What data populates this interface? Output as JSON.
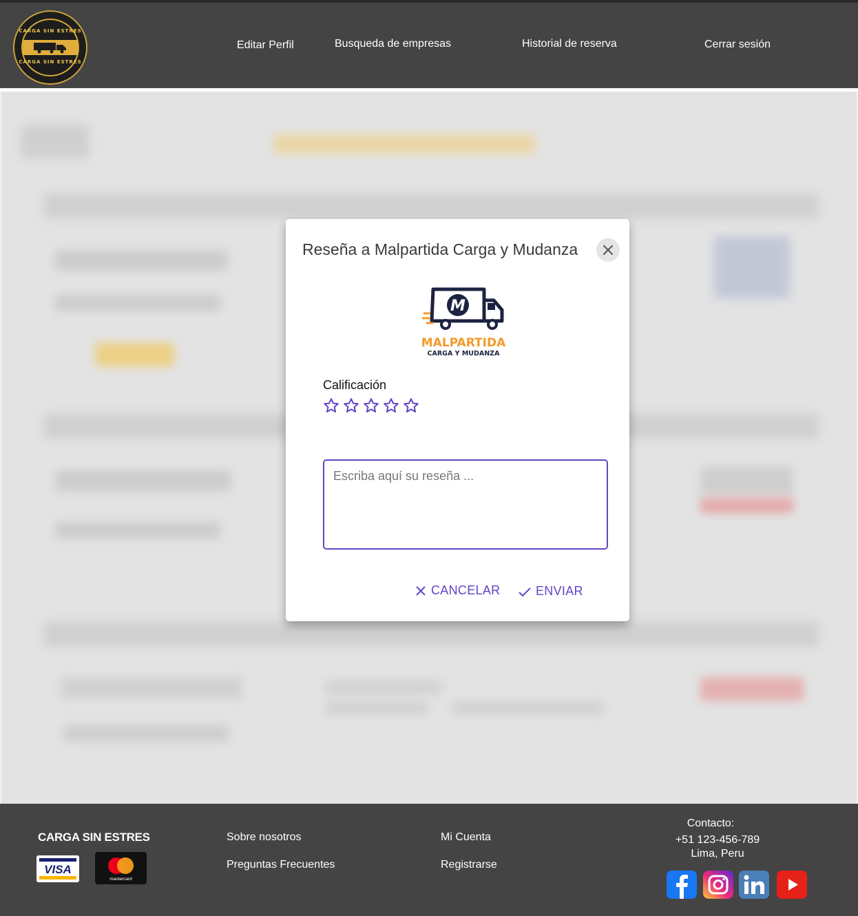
{
  "header": {
    "logo_text_top": "CARGA SIN ESTRES",
    "logo_text_bottom": "CARGA SIN ESTRES",
    "nav": {
      "edit_profile": "Editar Perfil",
      "company_search": "Busqueda de empresas",
      "booking_history": "Historial de reserva",
      "logout": "Cerrar sesión"
    }
  },
  "modal": {
    "title": "Reseña a Malpartida Carga y Mudanza",
    "company_logo": {
      "name": "MALPARTIDA",
      "tagline": "CARGA Y MUDANZA",
      "monogram": "M"
    },
    "rating_label": "Calificación",
    "stars": 5,
    "rating_value": 0,
    "review_placeholder": "Escriba aquí su reseña ...",
    "review_value": "",
    "cancel_label": "CANCELAR",
    "send_label": "ENVIAR"
  },
  "footer": {
    "brand": "CARGA SIN ESTRES",
    "links": {
      "about": "Sobre nosotros",
      "faq": "Preguntas Frecuentes",
      "account": "Mi Cuenta",
      "register": "Registrarse"
    },
    "contact": {
      "label": "Contacto:",
      "phone": "+51 123-456-789",
      "city": "Lima, Peru"
    },
    "payments": {
      "visa": "VISA",
      "mastercard": "mastercard"
    },
    "social_icons": [
      "facebook-icon",
      "instagram-icon",
      "linkedin-icon",
      "youtube-icon"
    ]
  },
  "colors": {
    "accent": "#6244c5",
    "header_bg": "#444444",
    "brand_gold": "#e1ae3d",
    "malpartida_orange": "#f39a2b",
    "malpartida_navy": "#1c2340"
  }
}
